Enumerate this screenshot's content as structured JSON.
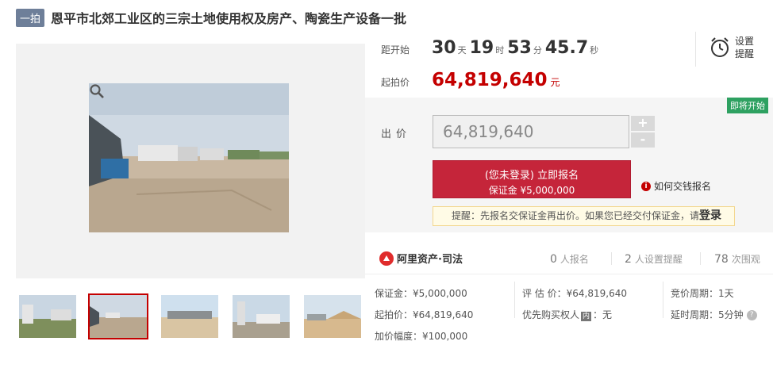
{
  "title": {
    "badge": "一拍",
    "text": "恩平市北郊工业区的三宗土地使用权及房产、陶瓷生产设备一批"
  },
  "timer": {
    "label": "距开始",
    "days": "30",
    "days_unit": "天",
    "hours": "19",
    "hours_unit": "时",
    "minutes": "53",
    "minutes_unit": "分",
    "seconds": "45.7",
    "seconds_unit": "秒"
  },
  "start_price": {
    "label": "起拍价",
    "value": "64,819,640",
    "unit": "元"
  },
  "remind": {
    "label": "设置提醒",
    "icon": "alarm-clock-icon"
  },
  "bid": {
    "badge": "即将开始",
    "label": "出价",
    "value": "64,819,640",
    "plus": "+",
    "minus": "-",
    "signup_main": "(您未登录) 立即报名",
    "signup_sub": "保证金 ¥5,000,000",
    "howto": "如何交钱报名",
    "notice_prefix": "提醒：先报名交保证金再出价。如果您已经交付保证金，请",
    "notice_login": "登录"
  },
  "stats": {
    "logo_text": "阿里资产·司法",
    "signups": "0",
    "signups_label": "人报名",
    "reminders": "2",
    "reminders_label": "人设置提醒",
    "views": "78",
    "views_label": "次围观"
  },
  "details": {
    "deposit": "保证金：¥5,000,000",
    "start_price": "起拍价：¥64,819,640",
    "increment": "加价幅度：¥100,000",
    "appraisal": "评 估 价：¥64,819,640",
    "priority_prefix": "优先购买权人",
    "priority_tag": "内",
    "priority_suffix": "：无",
    "cycle": "竞价周期：1天",
    "delay": "延时周期：5分钟"
  },
  "colors": {
    "accent": "#c40000",
    "button": "#c5253a",
    "badge_green": "#2ea161"
  }
}
